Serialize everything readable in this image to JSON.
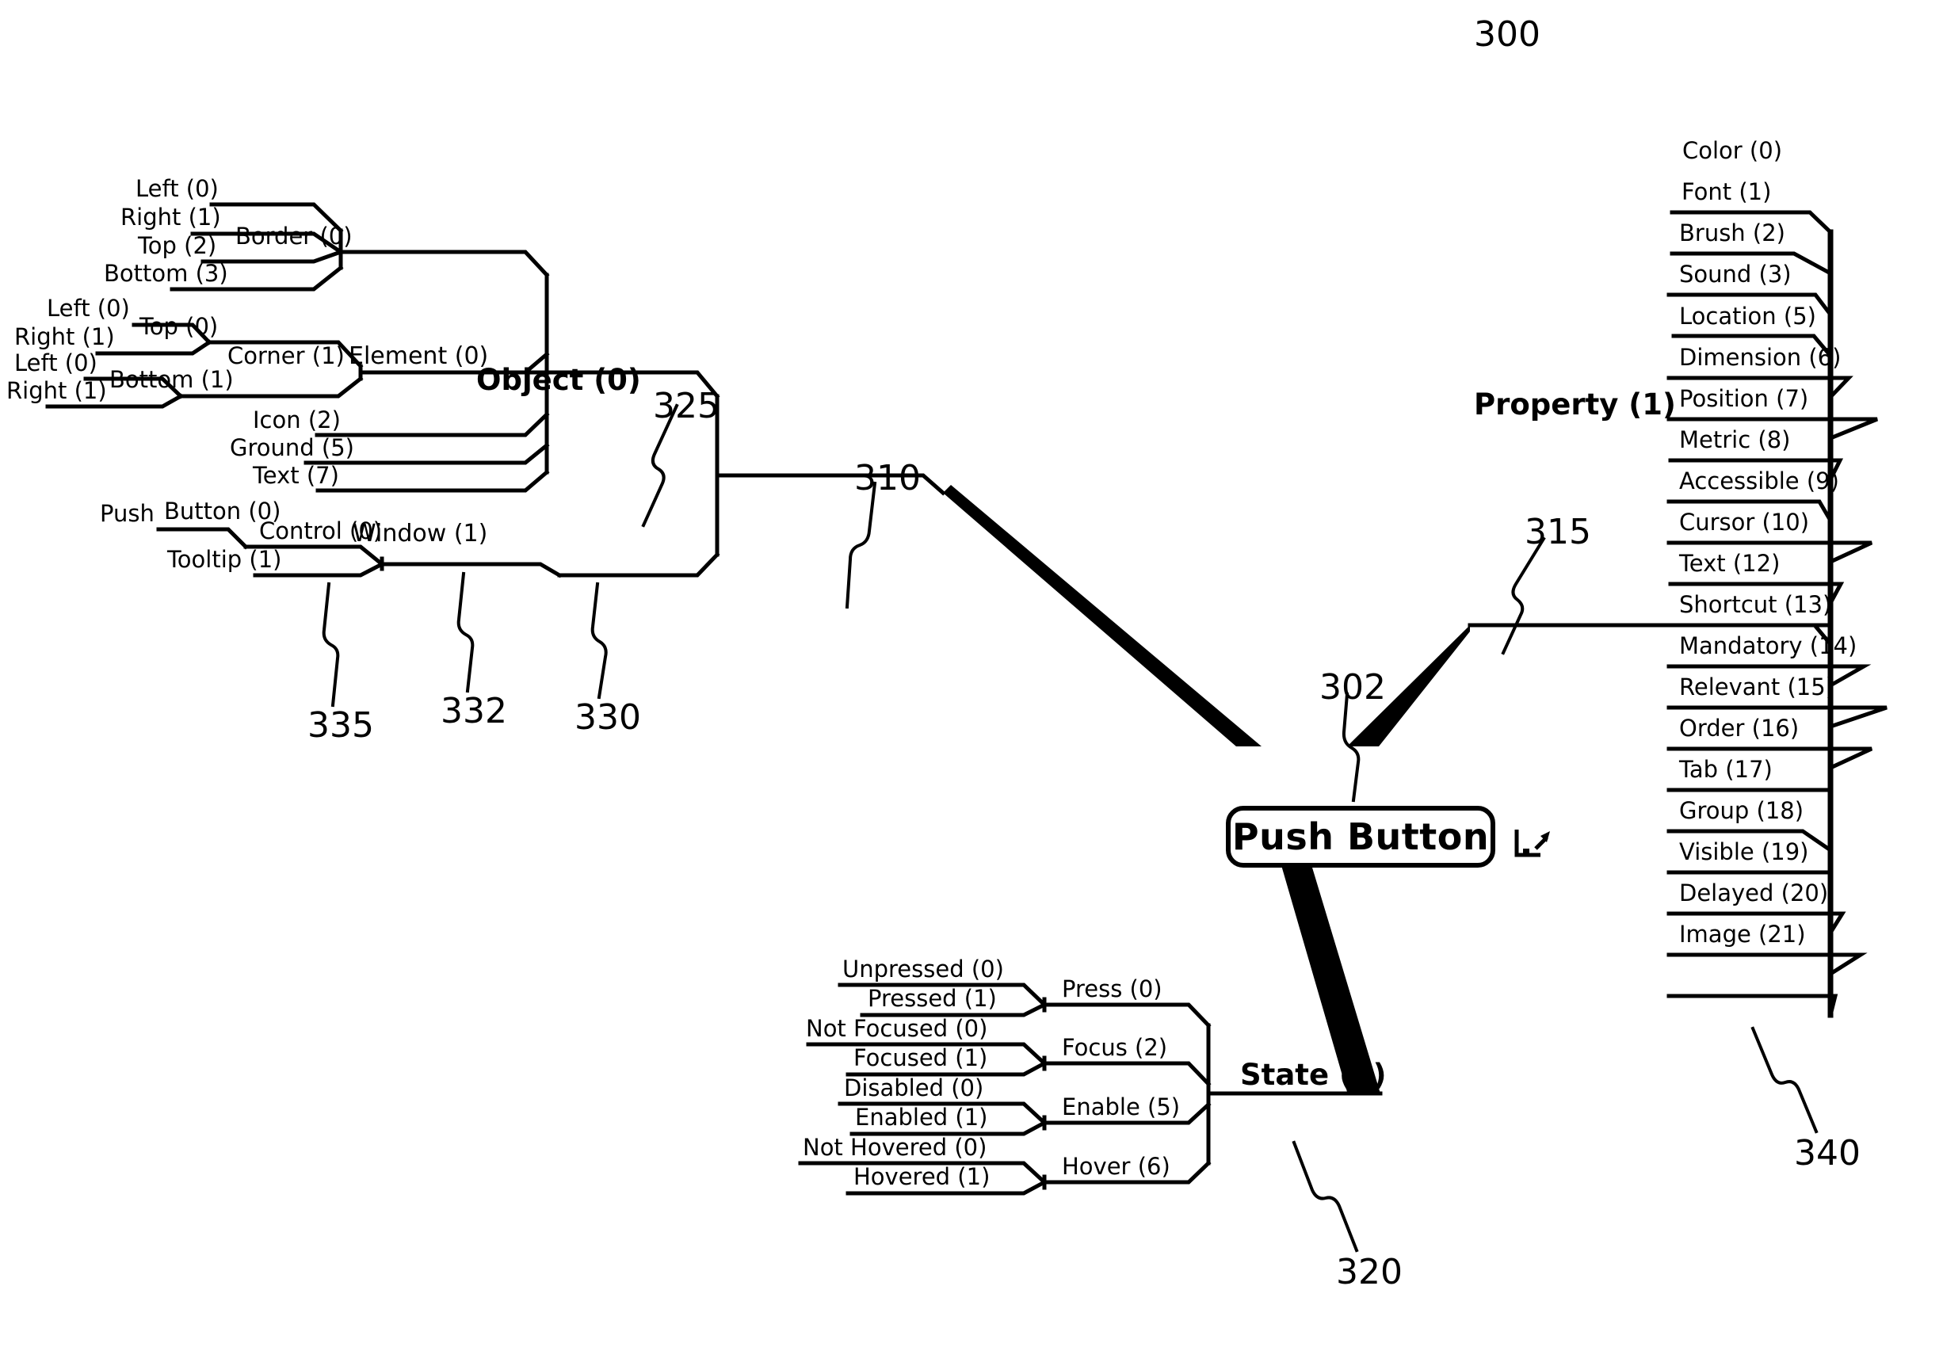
{
  "figure": {
    "number": "300",
    "center_node": "Push Button",
    "cursor_icon": "pointer-cursor-icon"
  },
  "reference_numerals": {
    "fig": "300",
    "center": "302",
    "object": "310",
    "property": "315",
    "state": "320",
    "element": "325",
    "window": "330",
    "control": "332",
    "tooltip": "335",
    "property_list": "340"
  },
  "branches": {
    "object": {
      "label": "Object (0)",
      "children": {
        "element": {
          "label": "Element (0)",
          "children": {
            "border": {
              "label": "Border (0)",
              "children": [
                "Left (0)",
                "Right (1)",
                "Top (2)",
                "Bottom (3)"
              ]
            },
            "corner": {
              "label": "Corner (1)",
              "children": {
                "top": {
                  "label": "Top (0)",
                  "children": [
                    "Left (0)",
                    "Right (1)"
                  ]
                },
                "bottom": {
                  "label": "Bottom (1)",
                  "children": [
                    "Left (0)",
                    "Right (1)"
                  ]
                }
              }
            },
            "leaves": [
              "Icon (2)",
              "Ground (5)",
              "Text (7)"
            ]
          }
        },
        "window": {
          "label": "Window (1)",
          "children": {
            "control": {
              "label": "Control (0)",
              "children": {
                "button": {
                  "label": "Button (0)",
                  "children": [
                    "Push"
                  ]
                },
                "tooltip": {
                  "label": "Tooltip (1)"
                }
              }
            }
          }
        }
      }
    },
    "property": {
      "label": "Property (1)",
      "items": [
        "Color (0)",
        "Font (1)",
        "Brush (2)",
        "Sound (3)",
        "Location (5)",
        "Dimension (6)",
        "Position (7)",
        "Metric (8)",
        "Accessible (9)",
        "Cursor (10)",
        "Text (12)",
        "Shortcut (13)",
        "Mandatory (14)",
        "Relevant (15)",
        "Order (16)",
        "Tab (17)",
        "Group (18)",
        "Visible (19)",
        "Delayed (20)",
        "Image (21)"
      ]
    },
    "state": {
      "label": "State (2)",
      "groups": [
        {
          "label": "Press (0)",
          "children": [
            "Unpressed (0)",
            "Pressed (1)"
          ]
        },
        {
          "label": "Focus (2)",
          "children": [
            "Not Focused (0)",
            "Focused (1)"
          ]
        },
        {
          "label": "Enable (5)",
          "children": [
            "Disabled (0)",
            "Enabled (1)"
          ]
        },
        {
          "label": "Hover (6)",
          "children": [
            "Not Hovered (0)",
            "Hovered (1)"
          ]
        }
      ]
    }
  },
  "colors": {
    "ink": "#000000",
    "paper": "#ffffff"
  }
}
